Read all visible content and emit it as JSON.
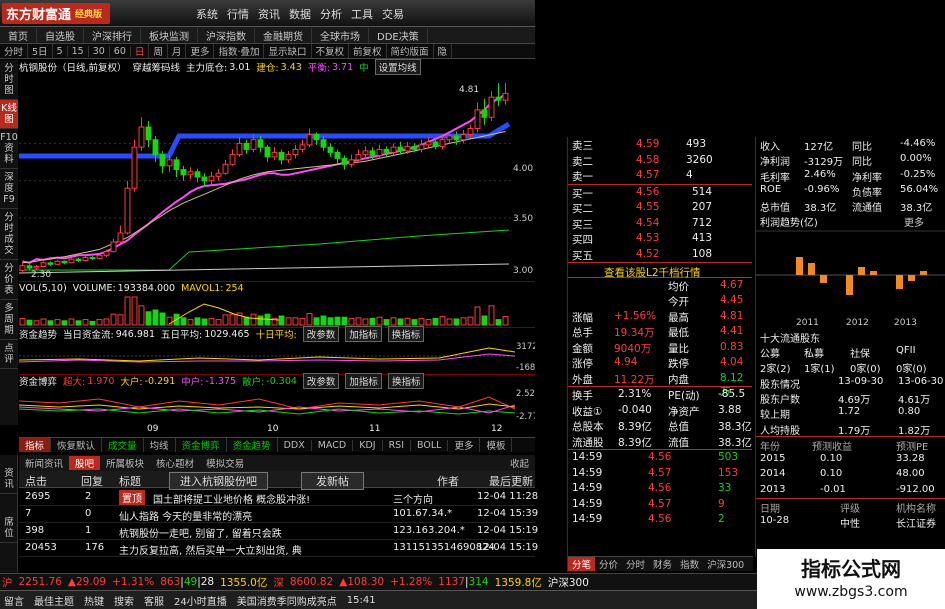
{
  "app": {
    "logo": "东方财富通",
    "edition": "经典版",
    "menu": [
      "系统",
      "行情",
      "资讯",
      "数据",
      "分析",
      "工具",
      "交易"
    ]
  },
  "nav": [
    "首页",
    "自选股",
    "沪深排行",
    "板块监测",
    "沪深指数",
    "金融期货",
    "全球市场",
    "DDE决策"
  ],
  "timeframes": [
    "分时",
    "5日",
    "5",
    "15",
    "30",
    "60",
    "日",
    "周",
    "月",
    "更多",
    "指数·叠加",
    "显示缺口",
    "不复权",
    "前复权",
    "简约版面",
    "隐"
  ],
  "side_tabs": [
    "分时图",
    "K线图",
    "F10资料",
    "深度F9",
    "分时成交",
    "分价表",
    "多周期",
    "点评",
    "资讯",
    "席位"
  ],
  "stock_head": {
    "name": "杭钢股份（日线,前复权）",
    "indicator": "穿越筹码线",
    "main_cost_label": "主力底仓:",
    "main_cost": "3.01",
    "jiancang_label": "建仓:",
    "jiancang": "3.43",
    "pingcang_label": "平衡:",
    "pingcang": "3.71",
    "zhong_label": "中",
    "setup_btn": "设置均线"
  },
  "price_labels": {
    "high": "4.81",
    "low": "2.30",
    "ticks": [
      "4.00",
      "3.50",
      "3.00"
    ]
  },
  "chart_data": {
    "type": "candlestick",
    "y_ticks": [
      4.0,
      3.5,
      3.0
    ],
    "high_label": 4.81,
    "low_label": 2.3,
    "x_labels": [
      "09",
      "10",
      "11",
      "12"
    ],
    "series": [
      {
        "values": [
          2.42,
          2.4,
          2.45,
          2.44,
          2.46,
          2.47,
          2.46,
          2.48,
          2.5,
          2.5,
          2.51,
          2.52,
          2.55,
          2.6,
          2.65,
          2.7,
          2.78,
          2.85,
          2.92,
          3.0,
          3.08,
          3.15,
          3.22,
          3.28,
          3.35,
          3.4,
          3.43,
          3.44,
          3.45,
          3.46,
          3.48,
          3.5,
          3.52,
          3.55,
          3.58,
          3.6,
          3.6,
          3.58,
          3.58,
          3.6,
          3.62,
          3.64,
          3.66,
          3.68,
          3.7,
          3.72,
          3.74,
          3.76,
          3.78,
          3.8,
          3.82,
          3.84,
          3.86,
          3.88,
          3.9,
          3.92,
          3.95,
          3.98,
          4.02,
          4.06,
          4.1,
          4.15,
          4.2,
          4.25,
          4.3,
          4.38,
          4.45,
          4.55,
          4.6,
          4.66
        ]
      },
      {
        "values": [
          2.4,
          2.41,
          2.42,
          2.44,
          2.45,
          2.47,
          2.48,
          2.5,
          2.52,
          2.54,
          2.56,
          2.58,
          2.62,
          2.66,
          2.7,
          2.74,
          2.8,
          2.86,
          2.92,
          2.98,
          3.04,
          3.1,
          3.15,
          3.2,
          3.24,
          3.28,
          3.32,
          3.36,
          3.4,
          3.44,
          3.48,
          3.52,
          3.55,
          3.58,
          3.6,
          3.62,
          3.63,
          3.64,
          3.65,
          3.66,
          3.67,
          3.68,
          3.69,
          3.7,
          3.71,
          3.72,
          3.73,
          3.74,
          3.75,
          3.76,
          3.78,
          3.8,
          3.82,
          3.84,
          3.86,
          3.88,
          3.9,
          3.92,
          3.94,
          3.96,
          3.98,
          4.0,
          4.02,
          4.04,
          4.06,
          4.08,
          4.1,
          4.12,
          4.14,
          4.16
        ]
      }
    ],
    "candles": [
      [
        2.3,
        2.36,
        2.28,
        2.4
      ],
      [
        2.36,
        2.33,
        2.3,
        2.38
      ],
      [
        2.33,
        2.35,
        2.31,
        2.37
      ],
      [
        2.35,
        2.4,
        2.34,
        2.42
      ],
      [
        2.4,
        2.38,
        2.36,
        2.42
      ],
      [
        2.38,
        2.42,
        2.37,
        2.44
      ],
      [
        2.42,
        2.4,
        2.38,
        2.43
      ],
      [
        2.4,
        2.45,
        2.39,
        2.47
      ],
      [
        2.45,
        2.43,
        2.41,
        2.47
      ],
      [
        2.43,
        2.47,
        2.42,
        2.49
      ],
      [
        2.47,
        2.46,
        2.44,
        2.49
      ],
      [
        2.46,
        2.5,
        2.45,
        2.52
      ],
      [
        2.5,
        2.55,
        2.48,
        2.58
      ],
      [
        2.55,
        2.68,
        2.54,
        2.72
      ],
      [
        2.68,
        2.8,
        2.66,
        2.9
      ],
      [
        2.8,
        3.4,
        2.78,
        3.5
      ],
      [
        3.4,
        3.95,
        3.35,
        4.05
      ],
      [
        3.95,
        4.22,
        3.9,
        4.35
      ],
      [
        4.22,
        4.05,
        3.95,
        4.3
      ],
      [
        4.05,
        3.85,
        3.75,
        4.1
      ],
      [
        3.85,
        3.7,
        3.6,
        3.9
      ],
      [
        3.7,
        3.78,
        3.62,
        3.85
      ],
      [
        3.78,
        3.65,
        3.55,
        3.82
      ],
      [
        3.65,
        3.58,
        3.5,
        3.7
      ],
      [
        3.58,
        3.62,
        3.52,
        3.68
      ],
      [
        3.62,
        3.55,
        3.48,
        3.66
      ],
      [
        3.55,
        3.5,
        3.42,
        3.6
      ],
      [
        3.5,
        3.56,
        3.45,
        3.62
      ],
      [
        3.56,
        3.6,
        3.5,
        3.66
      ],
      [
        3.6,
        3.72,
        3.58,
        3.78
      ],
      [
        3.72,
        3.85,
        3.7,
        3.92
      ],
      [
        3.85,
        4.0,
        3.82,
        4.08
      ],
      [
        4.0,
        3.92,
        3.86,
        4.05
      ],
      [
        3.92,
        4.05,
        3.88,
        4.12
      ],
      [
        4.05,
        3.95,
        3.88,
        4.1
      ],
      [
        3.95,
        3.82,
        3.75,
        3.98
      ],
      [
        3.82,
        3.88,
        3.78,
        3.95
      ],
      [
        3.88,
        3.78,
        3.72,
        3.92
      ],
      [
        3.78,
        3.85,
        3.74,
        3.9
      ],
      [
        3.85,
        3.92,
        3.8,
        3.98
      ],
      [
        3.92,
        3.98,
        3.88,
        4.05
      ],
      [
        3.98,
        4.12,
        3.95,
        4.2
      ],
      [
        4.12,
        4.05,
        3.98,
        4.15
      ],
      [
        4.05,
        3.95,
        3.9,
        4.1
      ],
      [
        3.95,
        3.88,
        3.82,
        4.0
      ],
      [
        3.88,
        3.8,
        3.72,
        3.92
      ],
      [
        3.8,
        3.72,
        3.65,
        3.84
      ],
      [
        3.72,
        3.78,
        3.68,
        3.85
      ],
      [
        3.78,
        3.85,
        3.75,
        3.92
      ],
      [
        3.85,
        3.9,
        3.8,
        3.96
      ],
      [
        3.9,
        3.84,
        3.78,
        3.95
      ],
      [
        3.84,
        3.92,
        3.8,
        3.98
      ],
      [
        3.92,
        3.88,
        3.82,
        3.96
      ],
      [
        3.88,
        3.95,
        3.84,
        4.0
      ],
      [
        3.95,
        3.9,
        3.85,
        4.02
      ],
      [
        3.9,
        3.96,
        3.86,
        4.02
      ],
      [
        3.96,
        3.92,
        3.88,
        4.0
      ],
      [
        3.92,
        3.98,
        3.88,
        4.05
      ],
      [
        3.98,
        4.02,
        3.94,
        4.08
      ],
      [
        4.02,
        3.96,
        3.92,
        4.06
      ],
      [
        3.96,
        4.05,
        3.92,
        4.1
      ],
      [
        4.05,
        4.1,
        4.0,
        4.15
      ],
      [
        4.1,
        4.05,
        3.98,
        4.16
      ],
      [
        4.05,
        4.12,
        4.0,
        4.18
      ],
      [
        4.12,
        4.2,
        4.08,
        4.25
      ],
      [
        4.2,
        4.45,
        4.15,
        4.55
      ],
      [
        4.45,
        4.35,
        4.25,
        4.6
      ],
      [
        4.35,
        4.62,
        4.3,
        4.7
      ],
      [
        4.62,
        4.58,
        4.5,
        4.81
      ],
      [
        4.58,
        4.67,
        4.52,
        4.81
      ]
    ]
  },
  "vol_head": {
    "label": "VOL(5,10)",
    "volume_label": "VOLUME:",
    "volume": "193384.000",
    "mavol_label": "MAVOL1:",
    "mavol": "254"
  },
  "fund_head": {
    "title": "资金趋势",
    "today_label": "当日资金流:",
    "today": "946.981",
    "five_label": "五日平均:",
    "five": "1029.465",
    "ten_label": "十日平均:",
    "btn1": "改参数",
    "btn2": "加指标",
    "btn3": "换指标",
    "ticks": [
      "3172",
      "-1680"
    ]
  },
  "game_head": {
    "title": "资金博弈",
    "super_label": "超大:",
    "super": "1.970",
    "big_label": "大户:",
    "big": "-0.291",
    "mid_label": "中户:",
    "mid": "-1.375",
    "small_label": "散户:",
    "small": "-0.304",
    "btn1": "改参数",
    "btn2": "加指标",
    "btn3": "换指标",
    "ticks": [
      "2.52",
      "-2.77"
    ]
  },
  "x_labels": [
    "09",
    "10",
    "11",
    "12"
  ],
  "idx_tabs": [
    "指标",
    "恢复默认",
    "成交量",
    "均线",
    "资金博弈",
    "资金趋势",
    "DDX",
    "MACD",
    "KDJ",
    "RSI",
    "BOLL",
    "更多",
    "模板"
  ],
  "news_tabs": [
    "新闻资讯",
    "股吧",
    "所属板块",
    "核心题材",
    "模拟交易"
  ],
  "news_collapse": "收起",
  "news_side": [
    "资讯",
    "席位"
  ],
  "forum_head": {
    "c1": "点击",
    "c2": "回复",
    "c3": "标题",
    "btn": "进入杭钢股份吧",
    "post": "发新帖",
    "author": "作者",
    "updated": "最后更新"
  },
  "forum_rows": [
    {
      "clicks": "2695",
      "replies": "2",
      "tag": "置顶",
      "title": "国土部将提工业地价格 概念股冲涨!",
      "author": "三个方向",
      "time": "12-04 11:28"
    },
    {
      "clicks": "7",
      "replies": "0",
      "tag": "",
      "title": "仙人指路 今天的量非常的漂亮",
      "author": "101.67.34.*",
      "time": "12-04 15:39"
    },
    {
      "clicks": "398",
      "replies": "1",
      "tag": "",
      "title": "杭钢股份一走吧, 别留了, 留着只会跌",
      "author": "123.163.204.*",
      "time": "12-04 15:19"
    },
    {
      "clicks": "20453",
      "replies": "176",
      "tag": "",
      "title": "主力反复拉高, 然后买单一大立刻出货, 典",
      "author": "1311513514690824",
      "time": "12-04 15:19"
    }
  ],
  "quotes": {
    "sell": [
      [
        "卖三",
        "4.59",
        "493"
      ],
      [
        "卖二",
        "4.58",
        "3260"
      ],
      [
        "卖一",
        "4.57",
        "4"
      ]
    ],
    "buy": [
      [
        "买一",
        "4.56",
        "514"
      ],
      [
        "买二",
        "4.55",
        "207"
      ],
      [
        "买三",
        "4.54",
        "712"
      ],
      [
        "买四",
        "4.53",
        "413"
      ],
      [
        "买五",
        "4.52",
        "108"
      ]
    ],
    "l2_link": "查看该股L2千档行情",
    "stats": [
      [
        "",
        "",
        "均价",
        "4.67"
      ],
      [
        "",
        "",
        "今开",
        "4.45"
      ],
      [
        "涨幅",
        "+1.56%",
        "最高",
        "4.81"
      ],
      [
        "总手",
        "19.34万",
        "最低",
        "4.41"
      ],
      [
        "金额",
        "9040万",
        "量比",
        "0.83"
      ],
      [
        "涨停",
        "4.94",
        "跌停",
        "4.04"
      ],
      [
        "外盘",
        "11.22万",
        "内盘",
        "8.12万"
      ]
    ],
    "fin": [
      [
        "换手",
        "2.31%",
        "PE(动)",
        "-85.5"
      ],
      [
        "收益①",
        "-0.040",
        "净资产",
        "3.88"
      ],
      [
        "总股本",
        "8.39亿",
        "总值",
        "38.3亿"
      ],
      [
        "流通股",
        "8.39亿",
        "流值",
        "38.3亿"
      ]
    ],
    "ticks": [
      [
        "14:59",
        "4.56",
        "503"
      ],
      [
        "14:59",
        "4.57",
        "153"
      ],
      [
        "14:59",
        "4.56",
        "33"
      ],
      [
        "14:59",
        "4.57",
        "9"
      ],
      [
        "14:59",
        "4.56",
        "2"
      ]
    ],
    "bottom_tabs": [
      "分笔",
      "分价",
      "分时",
      "财务",
      "指数",
      "沪深300"
    ]
  },
  "finance": {
    "rows": [
      [
        "收入",
        "127亿",
        "同比",
        "-4.46%"
      ],
      [
        "净利润",
        "-3129万",
        "同比",
        "0.00%"
      ],
      [
        "毛利率",
        "2.46%",
        "净利率",
        "-0.25%"
      ],
      [
        "ROE",
        "-0.96%",
        "负债率",
        "56.04%"
      ],
      [
        "总市值",
        "38.3亿",
        "流通值",
        "38.3亿"
      ]
    ],
    "trend_title": "利润趋势(亿)",
    "more": "更多",
    "years": [
      "2011",
      "2012",
      "2013"
    ],
    "bars": [
      0.45,
      0.3,
      -0.2,
      -0.5,
      0.2,
      0.1,
      -0.35,
      -0.15,
      0.1
    ],
    "holders_title": "十大流通股东",
    "holders_tabs": [
      "公募",
      "私募",
      "社保",
      "QFII"
    ],
    "holders_counts": [
      "2家(2)",
      "1家(1)",
      "0家(0)",
      "0家(0)"
    ],
    "holders_rows": [
      [
        "股东情况",
        "13-09-30",
        "13-06-30"
      ],
      [
        "股东户数",
        "4.69万",
        "4.61万"
      ],
      [
        "较上期",
        "1.72",
        "0.80"
      ],
      [
        "人均持股",
        "1.79万",
        "1.82万"
      ]
    ],
    "forecast_head": [
      "年份",
      "预测收益",
      "预测PE"
    ],
    "forecast": [
      [
        "2015",
        "0.10",
        "33.28"
      ],
      [
        "2014",
        "0.10",
        "48.00"
      ],
      [
        "2013",
        "-0.01",
        "-912.00"
      ]
    ],
    "rating_head": [
      "日期",
      "评级",
      "机构名称"
    ],
    "rating": [
      [
        "10-28",
        "中性",
        "长江证券"
      ]
    ]
  },
  "status": {
    "sh_label": "沪",
    "sh": "2251.76",
    "sh_ch": "▲29.09",
    "sh_pct": "+1.31%",
    "sh_up": "863",
    "sh_dn": "49",
    "sh_fl": "28",
    "sh_amt": "1355.0亿",
    "sz_label": "深",
    "sz": "8600.82",
    "sz_ch": "▲108.30",
    "sz_pct": "+1.28%",
    "sz_up": "1137",
    "sz_dn": "314",
    "sz_amt": "1359.8亿",
    "hs": "沪深300"
  },
  "taskbar": [
    "留言",
    "最佳主题",
    "热键",
    "搜索",
    "客服",
    "24小时直播",
    "美国消费季同购成亮点",
    "15:41"
  ],
  "watermark": {
    "title": "指标公式网",
    "url": "www.zbgs3.com"
  }
}
